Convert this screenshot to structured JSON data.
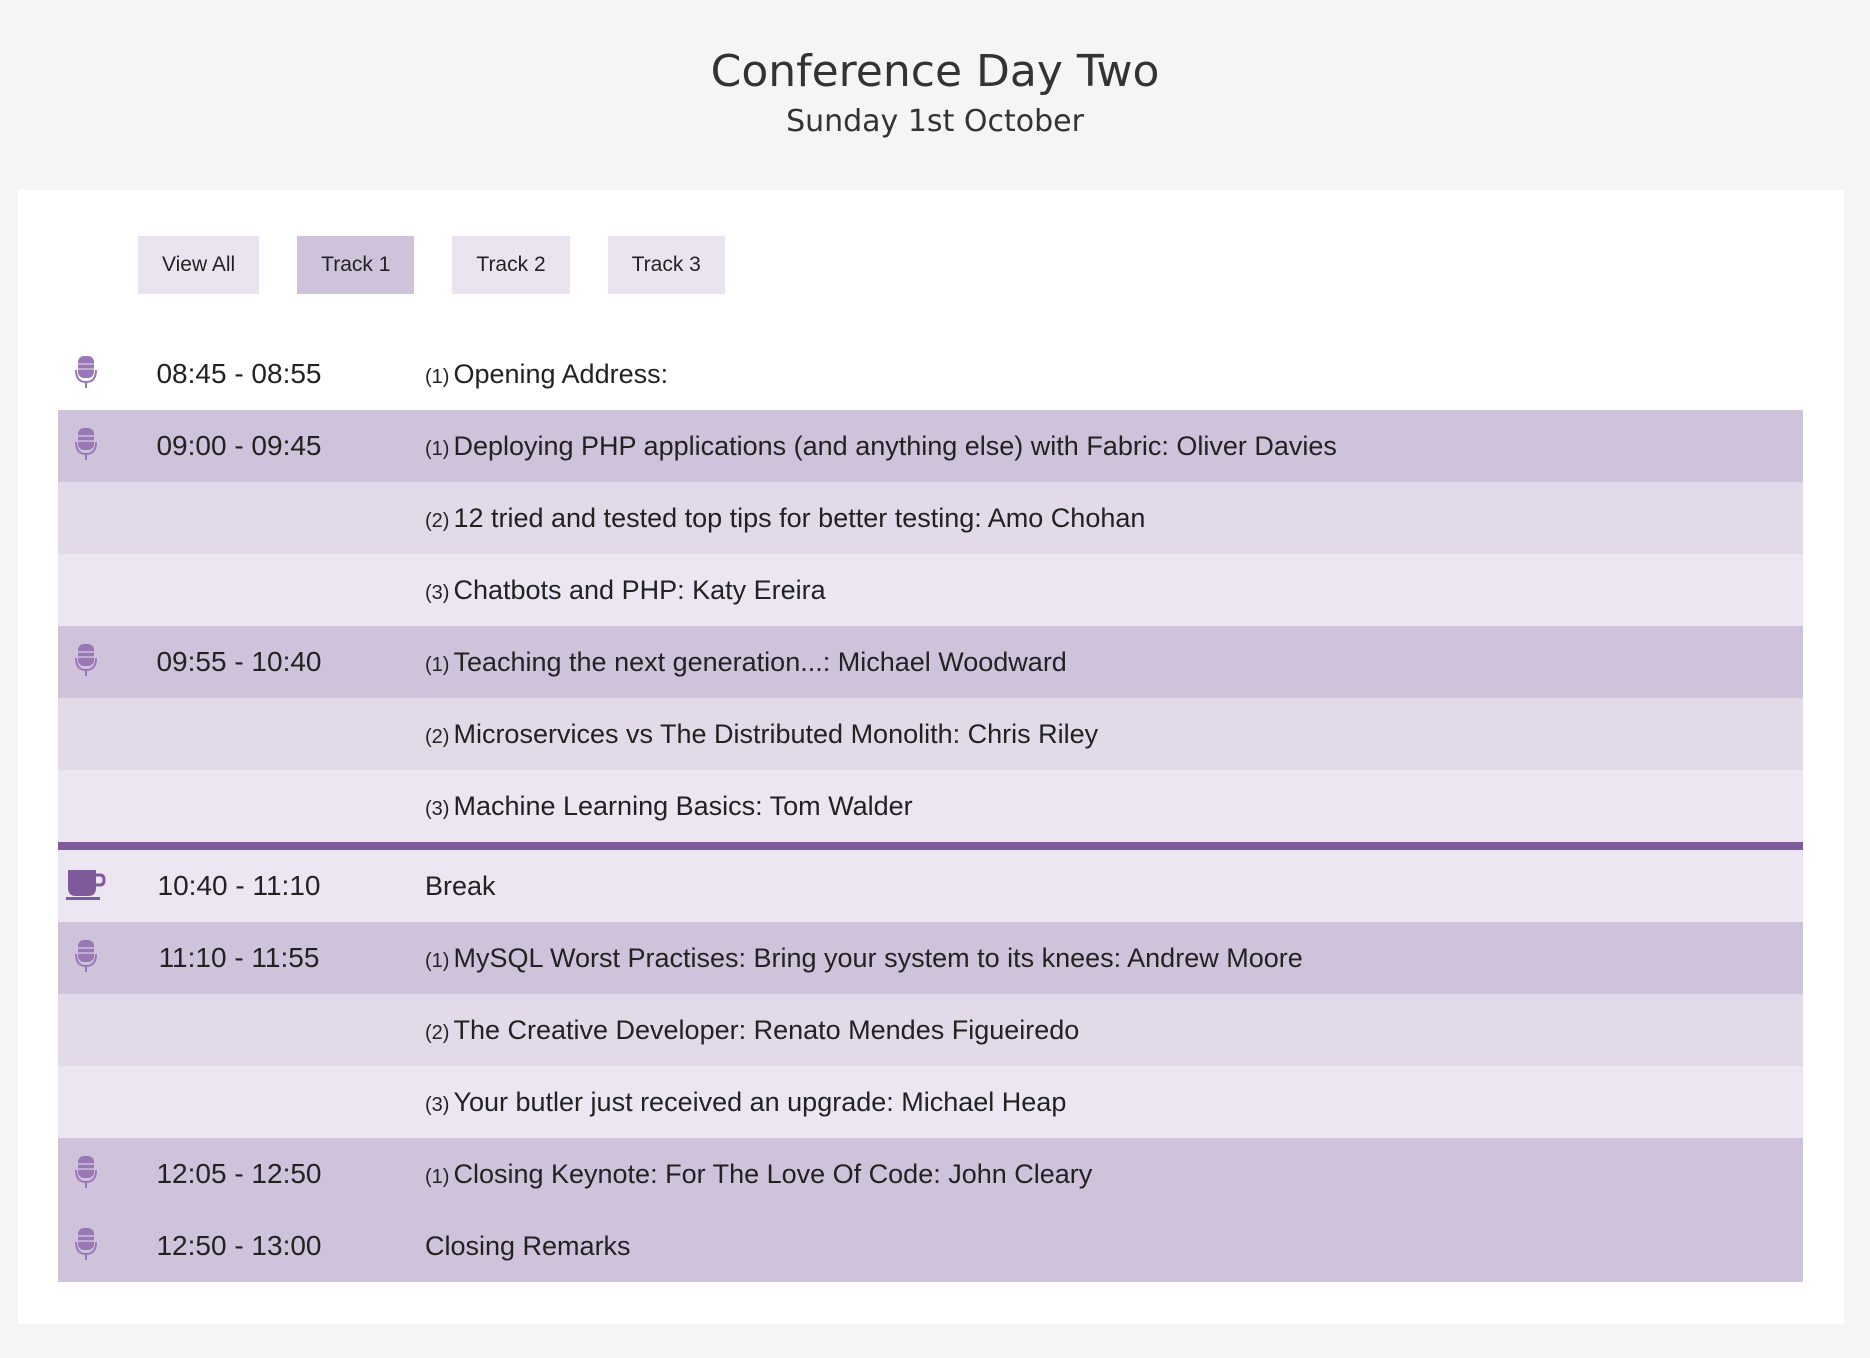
{
  "header": {
    "title": "Conference Day Two",
    "subtitle": "Sunday 1st October"
  },
  "filters": [
    {
      "label": "View All",
      "active": false
    },
    {
      "label": "Track 1",
      "active": true
    },
    {
      "label": "Track 2",
      "active": false
    },
    {
      "label": "Track 3",
      "active": false
    }
  ],
  "colors": {
    "accent": "#7d5a99",
    "icon": "#9a78b8",
    "row_primary": "#cfc2db",
    "row_secondary": "#e2dae9",
    "row_tertiary": "#ebe6f1"
  },
  "schedule": [
    {
      "icon": "mic-icon",
      "time": "08:45 - 08:55",
      "track": "(1)",
      "title": "Opening Address:",
      "shade": 0
    },
    {
      "icon": "mic-icon",
      "time": "09:00 - 09:45",
      "track": "(1)",
      "title": "Deploying PHP applications (and anything else) with Fabric: Oliver Davies",
      "shade": 1
    },
    {
      "icon": "",
      "time": "",
      "track": "(2)",
      "title": "12 tried and tested top tips for better testing: Amo Chohan",
      "shade": 2
    },
    {
      "icon": "",
      "time": "",
      "track": "(3)",
      "title": "Chatbots and PHP: Katy Ereira",
      "shade": 3
    },
    {
      "icon": "mic-icon",
      "time": "09:55 - 10:40",
      "track": "(1)",
      "title": "Teaching the next generation...: Michael Woodward",
      "shade": 1
    },
    {
      "icon": "",
      "time": "",
      "track": "(2)",
      "title": "Microservices vs The Distributed Monolith: Chris Riley",
      "shade": 2
    },
    {
      "icon": "",
      "time": "",
      "track": "(3)",
      "title": "Machine Learning Basics: Tom Walder",
      "shade": 3
    },
    {
      "icon": "cup-icon",
      "time": "10:40 - 11:10",
      "track": "",
      "title": "Break",
      "shade": 3,
      "is_break": true
    },
    {
      "icon": "mic-icon",
      "time": "11:10 - 11:55",
      "track": "(1)",
      "title": "MySQL Worst Practises: Bring your system to its knees: Andrew Moore",
      "shade": 1
    },
    {
      "icon": "",
      "time": "",
      "track": "(2)",
      "title": "The Creative Developer: Renato Mendes Figueiredo",
      "shade": 2
    },
    {
      "icon": "",
      "time": "",
      "track": "(3)",
      "title": "Your butler just received an upgrade: Michael Heap",
      "shade": 3
    },
    {
      "icon": "mic-icon",
      "time": "12:05 - 12:50",
      "track": "(1)",
      "title": "Closing Keynote: For The Love Of Code: John Cleary",
      "shade": 1
    },
    {
      "icon": "mic-icon",
      "time": "12:50 - 13:00",
      "track": "",
      "title": "Closing Remarks",
      "shade": 1
    }
  ]
}
